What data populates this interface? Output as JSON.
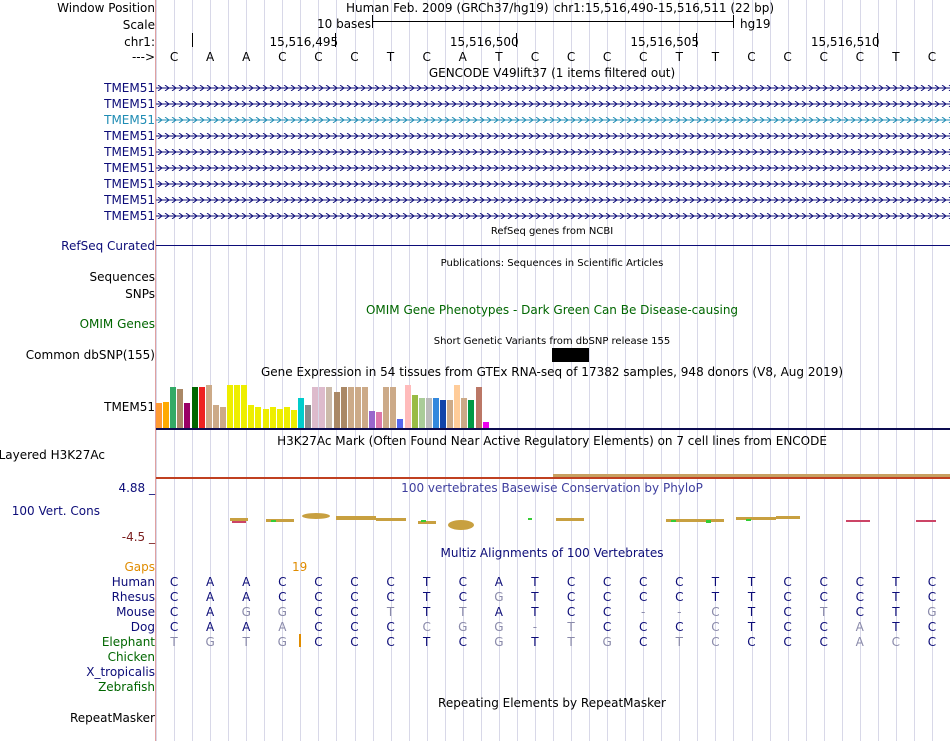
{
  "header": {
    "window_position_label": "Window Position",
    "scale_label": "Scale",
    "chrom_label": "chr1:",
    "strand_label": "--->",
    "assembly": "Human Feb. 2009 (GRCh37/hg19)",
    "position": "chr1:15,516,490-15,516,511 (22 bp)",
    "scale_text": "10 bases",
    "scale_db": "hg19",
    "coords": [
      "15,516,495",
      "15,516,500",
      "15,516,505",
      "15,516,510"
    ]
  },
  "sequence": [
    "C",
    "A",
    "A",
    "C",
    "C",
    "C",
    "T",
    "C",
    "A",
    "T",
    "C",
    "C",
    "C",
    "C",
    "T",
    "T",
    "C",
    "C",
    "C",
    "C",
    "T",
    "C"
  ],
  "tracks": {
    "gencode": {
      "title": "GENCODE V49lift37 (1 items filtered out)",
      "genes": [
        "TMEM51",
        "TMEM51",
        "TMEM51",
        "TMEM51",
        "TMEM51",
        "TMEM51",
        "TMEM51",
        "TMEM51",
        "TMEM51"
      ],
      "gene_colors": [
        "#0c0c78",
        "#0c0c78",
        "#1f8cb4",
        "#0c0c78",
        "#0c0c78",
        "#0c0c78",
        "#0c0c78",
        "#0c0c78",
        "#0c0c78"
      ]
    },
    "refseq": {
      "title": "RefSeq genes from NCBI",
      "label": "RefSeq Curated"
    },
    "publications": {
      "title": "Publications: Sequences in Scientific Articles",
      "label_sequences": "Sequences",
      "label_snps": "SNPs"
    },
    "omim": {
      "title": "OMIM Gene Phenotypes - Dark Green Can Be Disease-causing",
      "label": "OMIM Genes"
    },
    "dbsnp": {
      "title": "Short Genetic Variants from dbSNP release 155",
      "label": "Common dbSNP(155)"
    },
    "gtex": {
      "title": "Gene Expression in 54 tissues from GTEx RNA-seq of 17382 samples, 948 donors (V8, Aug 2019)",
      "label": "TMEM51",
      "bars": [
        {
          "c": "#ff9933",
          "h": 0.52
        },
        {
          "c": "#ffaa00",
          "h": 0.55
        },
        {
          "c": "#33aa66",
          "h": 0.85
        },
        {
          "c": "#aa8866",
          "h": 0.82
        },
        {
          "c": "#990066",
          "h": 0.52
        },
        {
          "c": "#006600",
          "h": 0.85
        },
        {
          "c": "#ee2222",
          "h": 0.85
        },
        {
          "c": "#ccaa88",
          "h": 0.9
        },
        {
          "c": "#ccaa88",
          "h": 0.48
        },
        {
          "c": "#ccaa88",
          "h": 0.43
        },
        {
          "c": "#eeee00",
          "h": 0.9
        },
        {
          "c": "#eeee00",
          "h": 0.9
        },
        {
          "c": "#eeee00",
          "h": 0.9
        },
        {
          "c": "#eeee00",
          "h": 0.48
        },
        {
          "c": "#eeee00",
          "h": 0.43
        },
        {
          "c": "#eeee00",
          "h": 0.4
        },
        {
          "c": "#eeee00",
          "h": 0.43
        },
        {
          "c": "#eeee00",
          "h": 0.4
        },
        {
          "c": "#eeee00",
          "h": 0.43
        },
        {
          "c": "#eeee00",
          "h": 0.38
        },
        {
          "c": "#00cccc",
          "h": 0.62
        },
        {
          "c": "#888888",
          "h": 0.48
        },
        {
          "c": "#ddbbcc",
          "h": 0.85
        },
        {
          "c": "#ddbbcc",
          "h": 0.85
        },
        {
          "c": "#ccbbaa",
          "h": 0.85
        },
        {
          "c": "#aa8866",
          "h": 0.75
        },
        {
          "c": "#aa8866",
          "h": 0.85
        },
        {
          "c": "#ccaa88",
          "h": 0.85
        },
        {
          "c": "#ccaa88",
          "h": 0.85
        },
        {
          "c": "#ccaa88",
          "h": 0.85
        },
        {
          "c": "#9966cc",
          "h": 0.35
        },
        {
          "c": "#dd77aa",
          "h": 0.33
        },
        {
          "c": "#ccaa88",
          "h": 0.85
        },
        {
          "c": "#ccaa88",
          "h": 0.85
        },
        {
          "c": "#5566ee",
          "h": 0.18
        },
        {
          "c": "#ffbbbb",
          "h": 0.9
        },
        {
          "c": "#99bb44",
          "h": 0.68
        },
        {
          "c": "#aacc99",
          "h": 0.62
        },
        {
          "c": "#bbbbbb",
          "h": 0.62
        },
        {
          "c": "#3388dd",
          "h": 0.62
        },
        {
          "c": "#1144aa",
          "h": 0.58
        },
        {
          "c": "#ccaa88",
          "h": 0.58
        },
        {
          "c": "#ffcc99",
          "h": 0.9
        },
        {
          "c": "#ccaa88",
          "h": 0.62
        },
        {
          "c": "#009944",
          "h": 0.58
        },
        {
          "c": "#bb7766",
          "h": 0.85
        },
        {
          "c": "#ee00ee",
          "h": 0.12
        }
      ]
    },
    "h3k27ac": {
      "title": "H3K27Ac Mark (Often Found Near Active Regulatory Elements) on 7 cell lines from ENCODE",
      "label": "Layered H3K27Ac"
    },
    "conservation": {
      "title": "100 vertebrates Basewise Conservation by PhyloP",
      "label": "100 Vert. Cons",
      "max_label": "4.88 _",
      "min_label": "-4.5 _"
    },
    "multiz": {
      "title": "Multiz Alignments of 100 Vertebrates",
      "gaps_label": "Gaps",
      "gaps_value": "19",
      "species": [
        {
          "name": "Human",
          "seq": [
            "C",
            "A",
            "A",
            "C",
            "C",
            "C",
            "C",
            "T",
            "C",
            "A",
            "T",
            "C",
            "C",
            "C",
            "C",
            "T",
            "T",
            "C",
            "C",
            "C",
            "T",
            "C"
          ],
          "dim": []
        },
        {
          "name": "Rhesus",
          "seq": [
            "C",
            "A",
            "A",
            "C",
            "C",
            "C",
            "C",
            "T",
            "C",
            "G",
            "T",
            "C",
            "C",
            "C",
            "C",
            "T",
            "T",
            "C",
            "C",
            "C",
            "T",
            "C"
          ],
          "dim": [
            9
          ]
        },
        {
          "name": "Mouse",
          "seq": [
            "C",
            "A",
            "G",
            "G",
            "C",
            "C",
            "T",
            "T",
            "T",
            "A",
            "T",
            "C",
            "C",
            "-",
            "-",
            "C",
            "T",
            "C",
            "T",
            "C",
            "T",
            "G"
          ],
          "dim": [
            2,
            3,
            6,
            8,
            13,
            14,
            15,
            18,
            21
          ]
        },
        {
          "name": "Dog",
          "seq": [
            "C",
            "A",
            "A",
            "A",
            "C",
            "C",
            "C",
            "C",
            "G",
            "G",
            "-",
            "T",
            "C",
            "C",
            "C",
            "C",
            "T",
            "C",
            "C",
            "A",
            "T",
            "C"
          ],
          "dim": [
            3,
            7,
            8,
            9,
            10,
            11,
            15,
            19
          ]
        },
        {
          "name": "Elephant",
          "seq": [
            "T",
            "G",
            "T",
            "G",
            "C",
            "C",
            "C",
            "T",
            "C",
            "G",
            "T",
            "T",
            "G",
            "C",
            "T",
            "C",
            "C",
            "C",
            "C",
            "A",
            "C",
            "C"
          ],
          "dim": [
            0,
            1,
            2,
            3,
            9,
            11,
            12,
            14,
            15,
            19,
            20
          ]
        },
        {
          "name": "Chicken",
          "seq": [],
          "dim": []
        },
        {
          "name": "X_tropicalis",
          "seq": [],
          "dim": []
        },
        {
          "name": "Zebrafish",
          "seq": [],
          "dim": []
        }
      ]
    },
    "repeatmasker": {
      "title": "Repeating Elements by RepeatMasker",
      "label": "RepeatMasker"
    }
  },
  "colors": {
    "label_blue": "#0c0c78",
    "label_green": "#006600",
    "label_orange": "#e08c00",
    "label_red": "#7a1e1e",
    "phylop_title": "#3e3e9e",
    "omim_title": "#006600"
  }
}
